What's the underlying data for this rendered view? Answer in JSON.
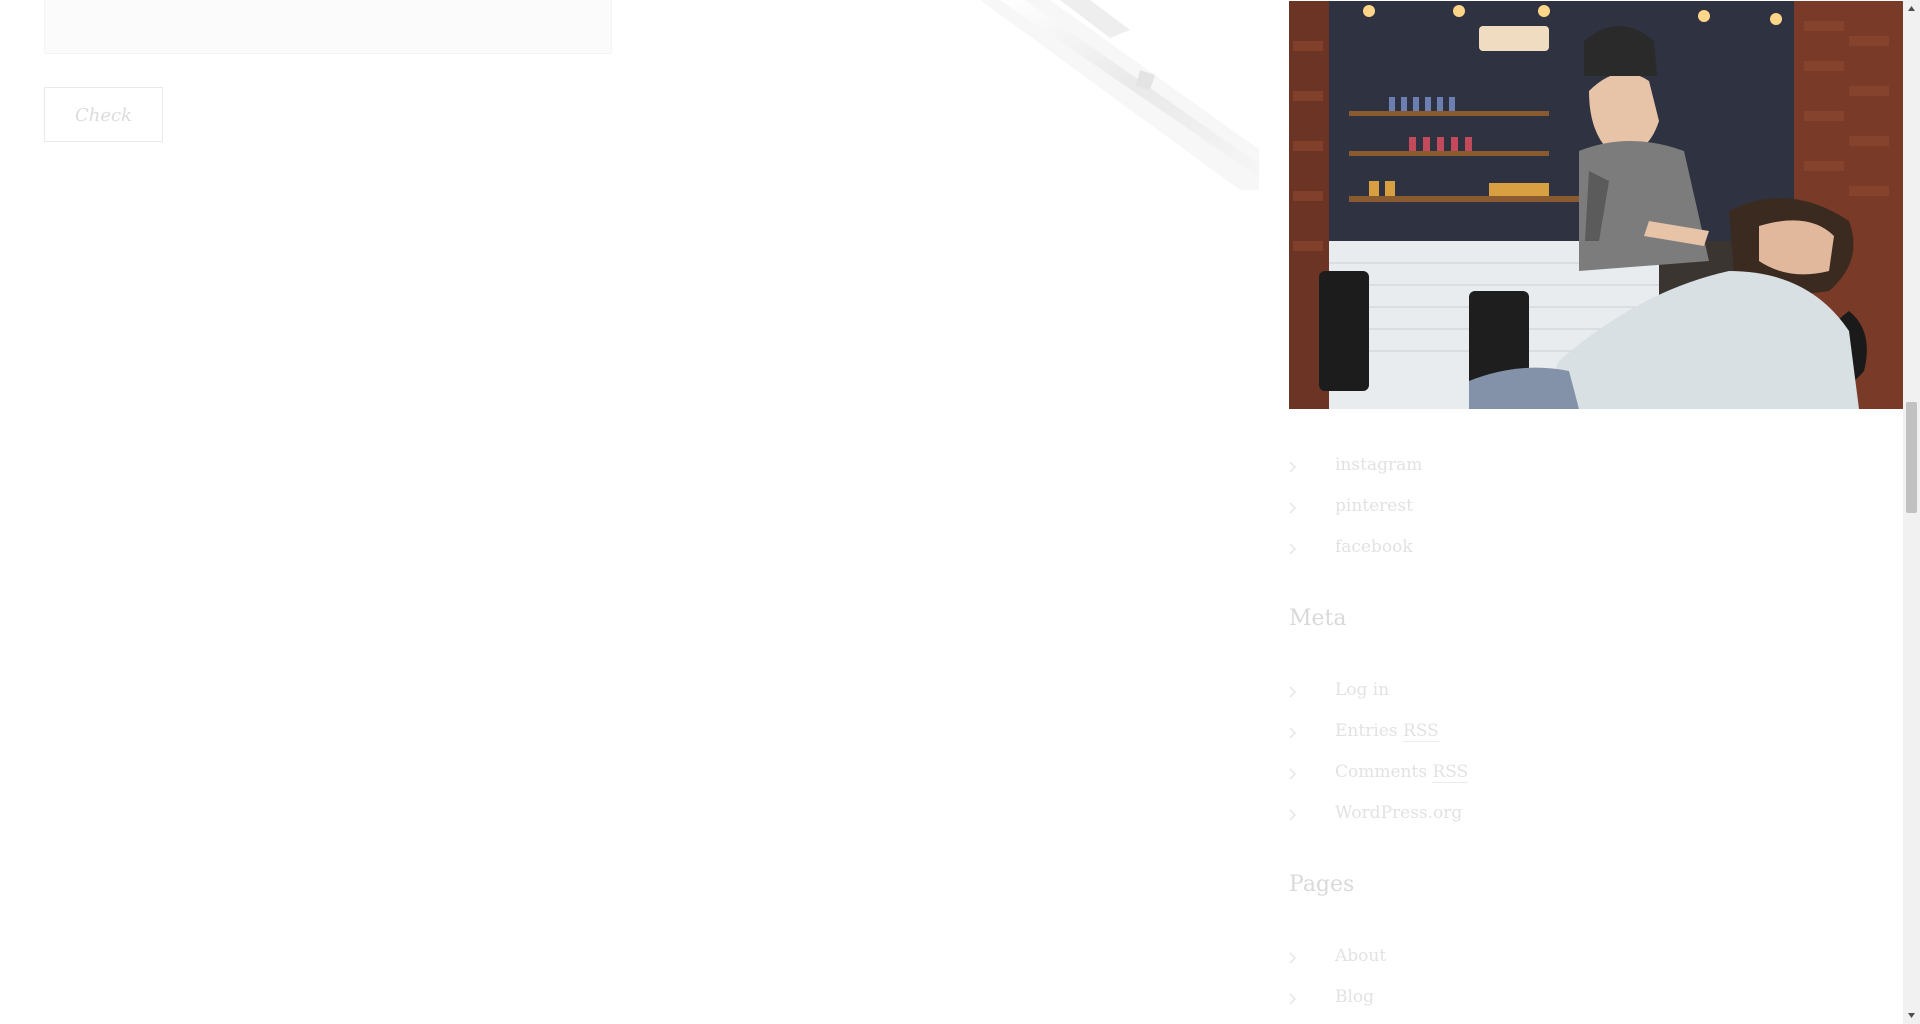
{
  "comment_form": {
    "check_button_label": "Check"
  },
  "sidebar": {
    "photo_description_icon": "barber-shop-photo",
    "social_links": [
      {
        "label": "instagram"
      },
      {
        "label": "pinterest"
      },
      {
        "label": "facebook"
      }
    ],
    "meta": {
      "title": "Meta",
      "links": [
        {
          "label": "Log in"
        },
        {
          "label": "Entries ",
          "suffix": "RSS"
        },
        {
          "label": "Comments ",
          "suffix": "RSS"
        },
        {
          "label": "WordPress.org"
        }
      ]
    },
    "pages": {
      "title": "Pages",
      "links": [
        {
          "label": "About"
        },
        {
          "label": "Blog"
        }
      ]
    }
  },
  "colors": {
    "faded_text": "#e2e2e2",
    "heading": "#d9d9d9",
    "scroll_thumb": "#c1c1c1"
  }
}
